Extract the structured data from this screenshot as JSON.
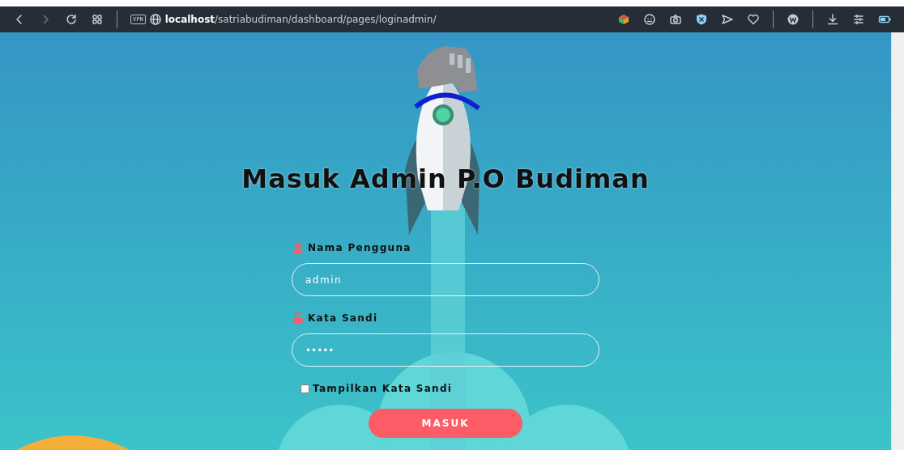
{
  "browser": {
    "vpn_label": "VPN",
    "address": {
      "host": "localhost",
      "path": "/satriabudiman/dashboard/pages/loginadmin/"
    }
  },
  "title": "Masuk Admin P.O Budiman",
  "fields": [
    {
      "kind": "user",
      "label": "Nama Pengguna",
      "value": "admin"
    },
    {
      "kind": "lock",
      "label": "Kata Sandi",
      "value": "•••••"
    }
  ],
  "show_password": {
    "label": "Tampilkan Kata Sandi",
    "checked": false
  },
  "submit": "MASUK"
}
